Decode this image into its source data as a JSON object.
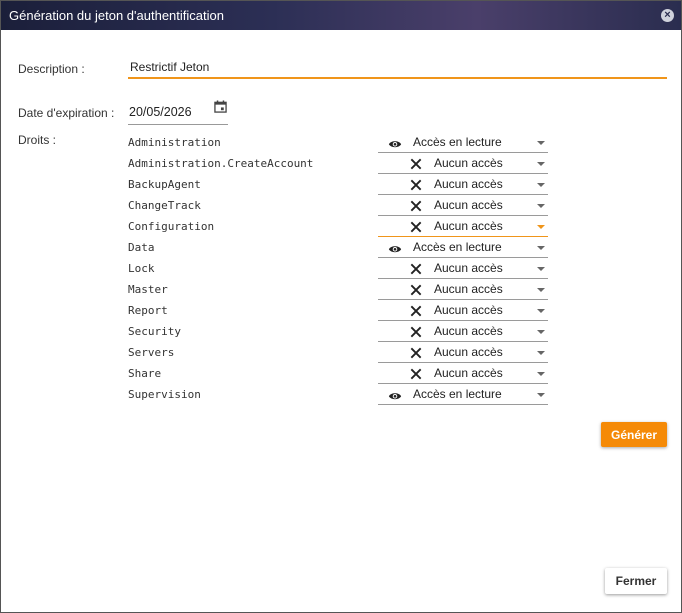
{
  "dialog": {
    "title": "Génération du jeton d'authentification",
    "close_icon": "close-icon"
  },
  "form": {
    "description_label": "Description :",
    "description_value": "Restrictif Jeton",
    "expiration_label": "Date d'expiration :",
    "expiration_value": "20/05/2026",
    "rights_label": "Droits :"
  },
  "permissions": [
    {
      "name": "Administration",
      "value": "Accès en lecture",
      "icon": "eye-icon"
    },
    {
      "name": "Administration.CreateAccount",
      "value": "Aucun accès",
      "icon": "x-icon"
    },
    {
      "name": "BackupAgent",
      "value": "Aucun accès",
      "icon": "x-icon"
    },
    {
      "name": "ChangeTrack",
      "value": "Aucun accès",
      "icon": "x-icon"
    },
    {
      "name": "Configuration",
      "value": "Aucun accès",
      "icon": "x-icon",
      "focused": true
    },
    {
      "name": "Data",
      "value": "Accès en lecture",
      "icon": "eye-icon"
    },
    {
      "name": "Lock",
      "value": "Aucun accès",
      "icon": "x-icon"
    },
    {
      "name": "Master",
      "value": "Aucun accès",
      "icon": "x-icon"
    },
    {
      "name": "Report",
      "value": "Aucun accès",
      "icon": "x-icon"
    },
    {
      "name": "Security",
      "value": "Aucun accès",
      "icon": "x-icon"
    },
    {
      "name": "Servers",
      "value": "Aucun accès",
      "icon": "x-icon"
    },
    {
      "name": "Share",
      "value": "Aucun accès",
      "icon": "x-icon"
    },
    {
      "name": "Supervision",
      "value": "Accès en lecture",
      "icon": "eye-icon"
    }
  ],
  "buttons": {
    "generate_label": "Générer",
    "close_label": "Fermer"
  },
  "colors": {
    "accent": "#f58a07",
    "titlebar": "#2c2f55"
  }
}
